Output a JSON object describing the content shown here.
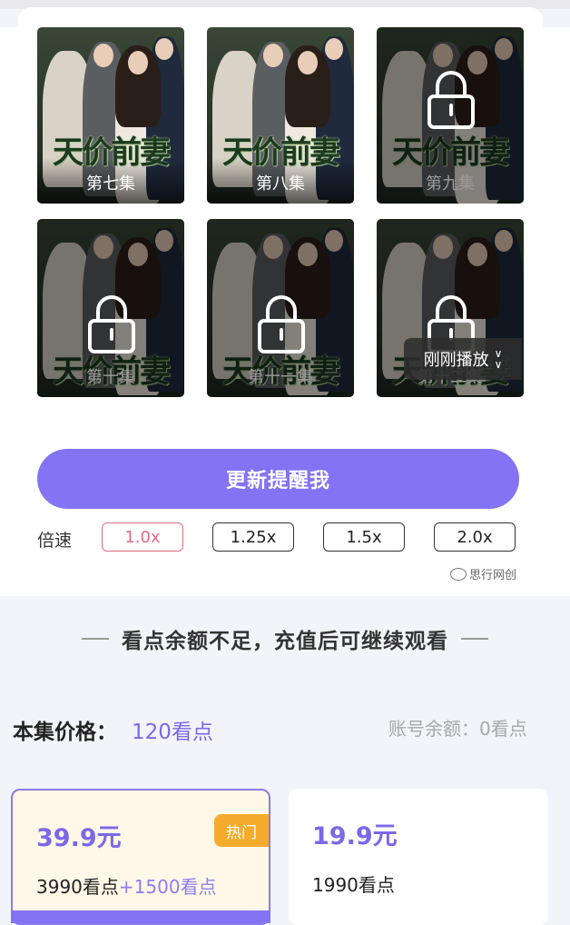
{
  "episodes": [
    {
      "label": "第七集",
      "locked": false
    },
    {
      "label": "第八集",
      "locked": false
    },
    {
      "label": "第九集",
      "locked": true
    },
    {
      "label": "第十集",
      "locked": true
    },
    {
      "label": "第十一集",
      "locked": true
    },
    {
      "label": "第十二集",
      "locked": true
    }
  ],
  "drama_title": "天价前妻",
  "recent_play": "刚刚播放",
  "remind_button": "更新提醒我",
  "speed": {
    "label": "倍速",
    "options": [
      "1.0x",
      "1.25x",
      "1.5x",
      "2.0x"
    ],
    "selected": "1.0x"
  },
  "watermark": "思行网创",
  "insufficient_notice": "看点余额不足，充值后可继续观看",
  "episode_price": {
    "label": "本集价格：",
    "value": "120看点"
  },
  "account_balance": "账号余额：0看点",
  "packages": [
    {
      "amount": "39.9元",
      "points": "3990看点",
      "bonus": "+1500看点",
      "badge": "热门",
      "selected": true
    },
    {
      "amount": "19.9元",
      "points": "1990看点",
      "selected": false
    }
  ],
  "colors": {
    "accent": "#8473f4",
    "price": "#7b68e8",
    "active_speed": "#e36a86",
    "badge": "#f5ac2c"
  }
}
